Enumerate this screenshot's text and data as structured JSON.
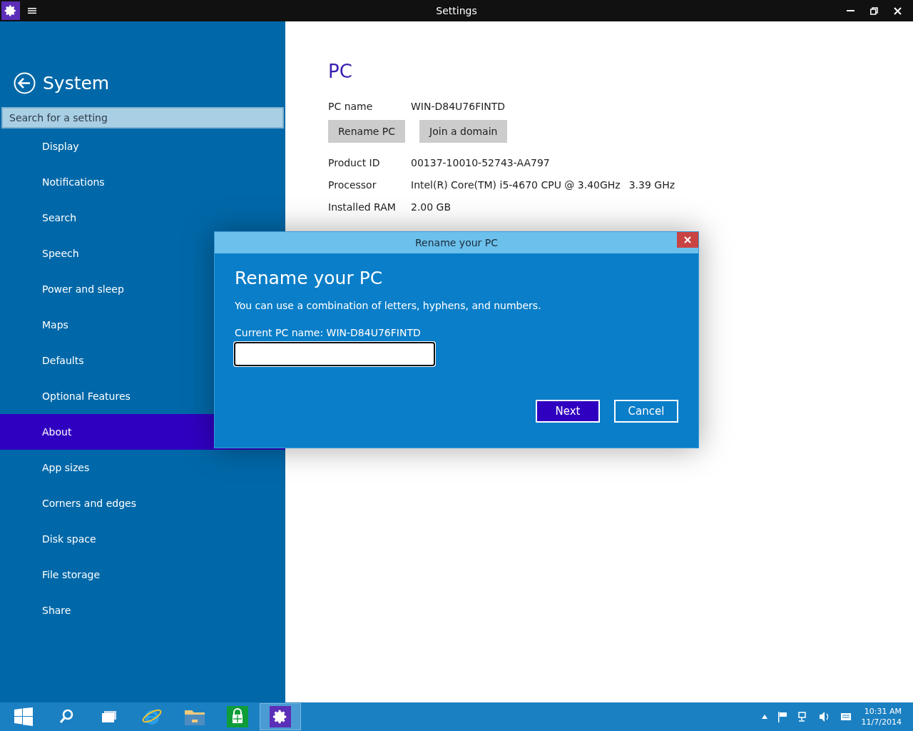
{
  "window": {
    "title": "Settings"
  },
  "sidebar": {
    "title": "System",
    "search": {
      "placeholder": "Search for a setting"
    },
    "items": [
      {
        "label": "Display",
        "selected": false
      },
      {
        "label": "Notifications",
        "selected": false
      },
      {
        "label": "Search",
        "selected": false
      },
      {
        "label": "Speech",
        "selected": false
      },
      {
        "label": "Power and sleep",
        "selected": false
      },
      {
        "label": "Maps",
        "selected": false
      },
      {
        "label": "Defaults",
        "selected": false
      },
      {
        "label": "Optional Features",
        "selected": false
      },
      {
        "label": "About",
        "selected": true
      },
      {
        "label": "App sizes",
        "selected": false
      },
      {
        "label": "Corners and edges",
        "selected": false
      },
      {
        "label": "Disk space",
        "selected": false
      },
      {
        "label": "File storage",
        "selected": false
      },
      {
        "label": "Share",
        "selected": false
      }
    ]
  },
  "content": {
    "heading": "PC",
    "pc_name": {
      "label": "PC name",
      "value": "WIN-D84U76FINTD"
    },
    "buttons": [
      "Rename PC",
      "Join a domain"
    ],
    "specs": [
      {
        "label": "Product ID",
        "value": "00137-10010-52743-AA797"
      },
      {
        "label": "Processor",
        "value": "Intel(R) Core(TM) i5-4670 CPU @ 3.40GHz",
        "extra": "3.39 GHz"
      },
      {
        "label": "Installed RAM",
        "value": "2.00 GB"
      }
    ]
  },
  "dialog": {
    "title": "Rename your PC",
    "heading": "Rename your PC",
    "description": "You can use a combination of letters, hyphens, and numbers.",
    "current_name": "Current PC name: WIN-D84U76FINTD",
    "buttons": [
      {
        "label": "Next",
        "kind": "primary"
      },
      {
        "label": "Cancel",
        "kind": "secondary"
      }
    ]
  },
  "taskbar": {
    "apps": [
      {
        "kind": "search",
        "selected": false
      },
      {
        "kind": "task-view",
        "selected": false
      },
      {
        "kind": "browser",
        "selected": false
      },
      {
        "kind": "folder",
        "selected": false
      },
      {
        "kind": "store",
        "selected": false
      },
      {
        "kind": "settings",
        "selected": true
      }
    ],
    "time": "10:31 AM",
    "date": "11/7/2014"
  }
}
